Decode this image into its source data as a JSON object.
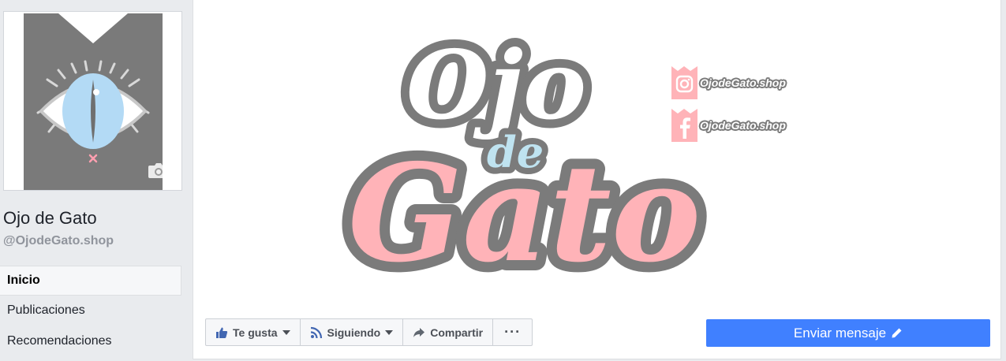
{
  "page": {
    "name": "Ojo de Gato",
    "handle": "@OjodeGato.shop"
  },
  "nav": {
    "items": [
      {
        "label": "Inicio",
        "active": true
      },
      {
        "label": "Publicaciones",
        "active": false
      },
      {
        "label": "Recomendaciones",
        "active": false
      }
    ]
  },
  "cover": {
    "logo": {
      "line1": "Ojo",
      "line2": "de",
      "line3": "Gato"
    },
    "social": [
      {
        "icon": "instagram-icon",
        "handle": "OjodeGato.shop"
      },
      {
        "icon": "facebook-icon",
        "handle": "OjodeGato.shop"
      }
    ]
  },
  "actions": {
    "like_label": "Te gusta",
    "follow_label": "Siguiendo",
    "share_label": "Compartir",
    "more_label": "···",
    "message_label": "Enviar mensaje"
  },
  "colors": {
    "accent": "#4080ff",
    "logo_gray": "#7b7b7b",
    "logo_pink": "#ffb3b8",
    "logo_blue": "#bfe3f0",
    "eye_blue": "#b3daf5",
    "profile_gray": "#7a7a7a"
  }
}
